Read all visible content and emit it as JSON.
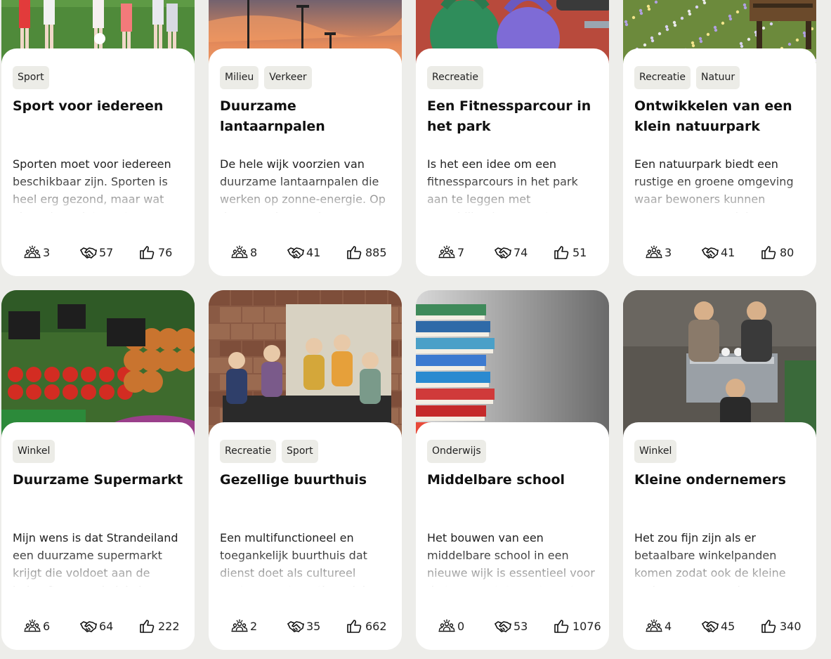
{
  "cards": [
    {
      "tags": [
        "Sport"
      ],
      "title": "Sport voor iedereen",
      "description": "Sporten moet voor iedereen beschikbaar zijn. Sporten is heel erg gezond, maar wat als andere niet sporten",
      "members": "3",
      "supporters": "57",
      "likes": "76",
      "image": "youth-football-on-grass"
    },
    {
      "tags": [
        "Milieu",
        "Verkeer"
      ],
      "title": "Duurzame lantaarnpalen",
      "description": "De hele wijk voorzien van duurzame lantaarnpalen die werken op zonne-energie. Op deze manier word",
      "members": "8",
      "supporters": "41",
      "likes": "885",
      "image": "streetlights-at-sunset"
    },
    {
      "tags": [
        "Recreatie"
      ],
      "title": "Een Fitnessparcour in het park",
      "description": "Is het een idee om een fitnessparcours in het park aan te leggen met verschillende apparaten en",
      "members": "7",
      "supporters": "74",
      "likes": "51",
      "image": "kettlebells-on-track"
    },
    {
      "tags": [
        "Recreatie",
        "Natuur"
      ],
      "title": "Ontwikkelen van een klein natuurpark",
      "description": "Een natuurpark biedt een rustige en groene omgeving waar bewoners kunnen ontspannen, wandelen",
      "members": "3",
      "supporters": "41",
      "likes": "80",
      "image": "bench-in-flower-meadow"
    },
    {
      "tags": [
        "Winkel"
      ],
      "title": "Duurzame Supermarkt",
      "description": "Mijn wens is dat Strandeiland een duurzame supermarkt krijgt die voldoet aan de behoeften van de lokale",
      "members": "6",
      "supporters": "64",
      "likes": "222",
      "image": "vegetable-market-stall"
    },
    {
      "tags": [
        "Recreatie",
        "Sport"
      ],
      "title": "Gezellige buurthuis",
      "description": "Een multifunctioneel en toegankelijk buurthuis dat dienst doet als cultureel centrum, ontmoetingsplek en",
      "members": "2",
      "supporters": "35",
      "likes": "662",
      "image": "community-center-gathering"
    },
    {
      "tags": [
        "Onderwijs"
      ],
      "title": "Middelbare school",
      "description": "Het bouwen van een middelbare school in een nieuwe wijk is essentieel voor de toegang tot voortgezet",
      "members": "0",
      "supporters": "53",
      "likes": "1076",
      "image": "stack-of-books"
    },
    {
      "tags": [
        "Winkel"
      ],
      "title": "Kleine ondernemers",
      "description": "Het zou fijn zijn als er betaalbare winkelpanden komen zodat ook de kleine ondernemers een kans",
      "members": "4",
      "supporters": "45",
      "likes": "340",
      "image": "coffee-bar-baristas"
    }
  ],
  "icons": {
    "members": "community-icon",
    "supporters": "handshake-icon",
    "likes": "thumbs-up-icon"
  },
  "colors": {
    "page_background": "#ededea",
    "tag_background": "#ecece7",
    "card_background": "#ffffff"
  }
}
